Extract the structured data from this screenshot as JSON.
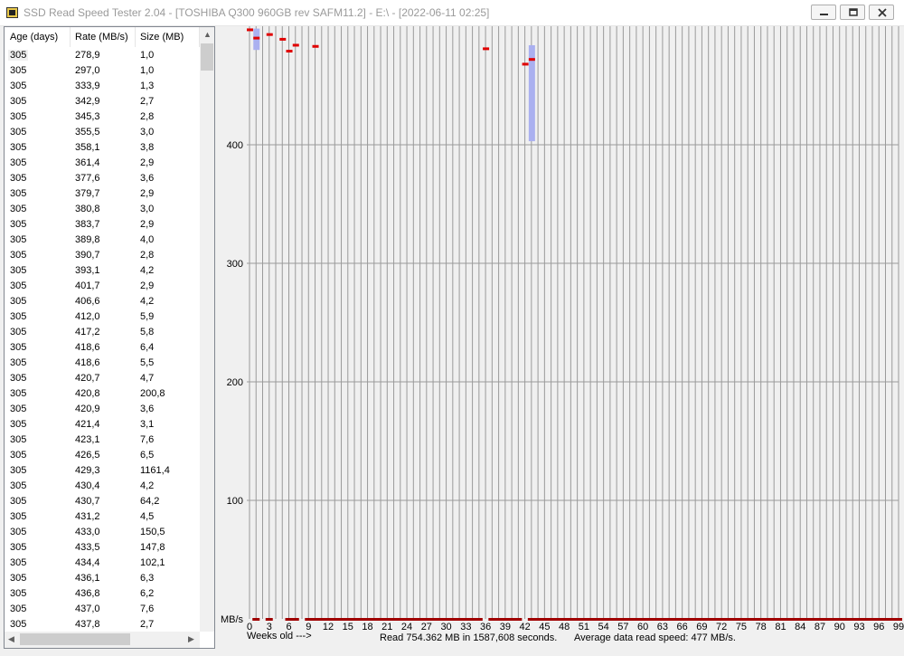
{
  "window": {
    "title": "SSD Read Speed Tester 2.04 - [TOSHIBA Q300 960GB rev SAFM11.2] - E:\\ - [2022-06-11 02:25]"
  },
  "list": {
    "headers": {
      "age": "Age (days)",
      "rate": "Rate (MB/s)",
      "size": "Size (MB)"
    },
    "rows": [
      [
        "305",
        "278,9",
        "1,0"
      ],
      [
        "305",
        "297,0",
        "1,0"
      ],
      [
        "305",
        "333,9",
        "1,3"
      ],
      [
        "305",
        "342,9",
        "2,7"
      ],
      [
        "305",
        "345,3",
        "2,8"
      ],
      [
        "305",
        "355,5",
        "3,0"
      ],
      [
        "305",
        "358,1",
        "3,8"
      ],
      [
        "305",
        "361,4",
        "2,9"
      ],
      [
        "305",
        "377,6",
        "3,6"
      ],
      [
        "305",
        "379,7",
        "2,9"
      ],
      [
        "305",
        "380,8",
        "3,0"
      ],
      [
        "305",
        "383,7",
        "2,9"
      ],
      [
        "305",
        "389,8",
        "4,0"
      ],
      [
        "305",
        "390,7",
        "2,8"
      ],
      [
        "305",
        "393,1",
        "4,2"
      ],
      [
        "305",
        "401,7",
        "2,9"
      ],
      [
        "305",
        "406,6",
        "4,2"
      ],
      [
        "305",
        "412,0",
        "5,9"
      ],
      [
        "305",
        "417,2",
        "5,8"
      ],
      [
        "305",
        "418,6",
        "6,4"
      ],
      [
        "305",
        "418,6",
        "5,5"
      ],
      [
        "305",
        "420,7",
        "4,7"
      ],
      [
        "305",
        "420,8",
        "200,8"
      ],
      [
        "305",
        "420,9",
        "3,6"
      ],
      [
        "305",
        "421,4",
        "3,1"
      ],
      [
        "305",
        "423,1",
        "7,6"
      ],
      [
        "305",
        "426,5",
        "6,5"
      ],
      [
        "305",
        "429,3",
        "1161,4"
      ],
      [
        "305",
        "430,4",
        "4,2"
      ],
      [
        "305",
        "430,7",
        "64,2"
      ],
      [
        "305",
        "431,2",
        "4,5"
      ],
      [
        "305",
        "433,0",
        "150,5"
      ],
      [
        "305",
        "433,5",
        "147,8"
      ],
      [
        "305",
        "434,4",
        "102,1"
      ],
      [
        "305",
        "436,1",
        "6,3"
      ],
      [
        "305",
        "436,8",
        "6,2"
      ],
      [
        "305",
        "437,0",
        "7,6"
      ],
      [
        "305",
        "437,8",
        "2,7"
      ]
    ]
  },
  "chart_data": {
    "type": "bar",
    "ylabel": "MB/s",
    "xlabel": "Weeks old --->",
    "y_ticks": [
      100,
      200,
      300,
      400
    ],
    "x_ticks": [
      0,
      3,
      6,
      9,
      12,
      15,
      18,
      21,
      24,
      27,
      30,
      33,
      36,
      39,
      42,
      45,
      48,
      51,
      54,
      57,
      60,
      63,
      66,
      69,
      72,
      75,
      78,
      81,
      84,
      87,
      90,
      93,
      96,
      99
    ],
    "ylim": [
      0,
      500
    ],
    "xlim": [
      0,
      99
    ],
    "colors": {
      "mean": "#e00000",
      "range": "#aab0f0",
      "grid": "#9a9a9a",
      "zero_line": "#a00000"
    },
    "points": [
      {
        "week": 0,
        "mean": 497,
        "low": 497,
        "high": 497
      },
      {
        "week": 1,
        "mean": 490,
        "low": 480,
        "high": 498
      },
      {
        "week": 3,
        "mean": 493,
        "low": 493,
        "high": 493
      },
      {
        "week": 5,
        "mean": 489,
        "low": 489,
        "high": 489
      },
      {
        "week": 6,
        "mean": 479,
        "low": 479,
        "high": 479
      },
      {
        "week": 7,
        "mean": 484,
        "low": 484,
        "high": 484
      },
      {
        "week": 10,
        "mean": 483,
        "low": 483,
        "high": 483
      },
      {
        "week": 36,
        "mean": 481,
        "low": 481,
        "high": 481
      },
      {
        "week": 42,
        "mean": 468,
        "low": 468,
        "high": 468
      },
      {
        "week": 43,
        "mean": 472,
        "low": 403,
        "high": 484
      }
    ],
    "zero_weeks": [
      1,
      3,
      6,
      7,
      9,
      10,
      11,
      12,
      13,
      14,
      15,
      16,
      17,
      18,
      19,
      20,
      21,
      22,
      23,
      24,
      25,
      26,
      27,
      28,
      29,
      30,
      31,
      32,
      33,
      34,
      35,
      37,
      38,
      39,
      40,
      41,
      43,
      44,
      45,
      46,
      47,
      48,
      49,
      50,
      51,
      52,
      53,
      54,
      55,
      56,
      57,
      58,
      59,
      60,
      61,
      62,
      63,
      64,
      65,
      66,
      67,
      68,
      69,
      70,
      71,
      72,
      73,
      74,
      75,
      76,
      77,
      78,
      79,
      80,
      81,
      82,
      83,
      84,
      85,
      86,
      87,
      88,
      89,
      90,
      91,
      92,
      93,
      94,
      95,
      96,
      97,
      98,
      99
    ]
  },
  "footer": {
    "read_summary": "Read 754.362 MB in 1587,608 seconds.",
    "avg_speed": "Average data read speed: 477 MB/s."
  }
}
